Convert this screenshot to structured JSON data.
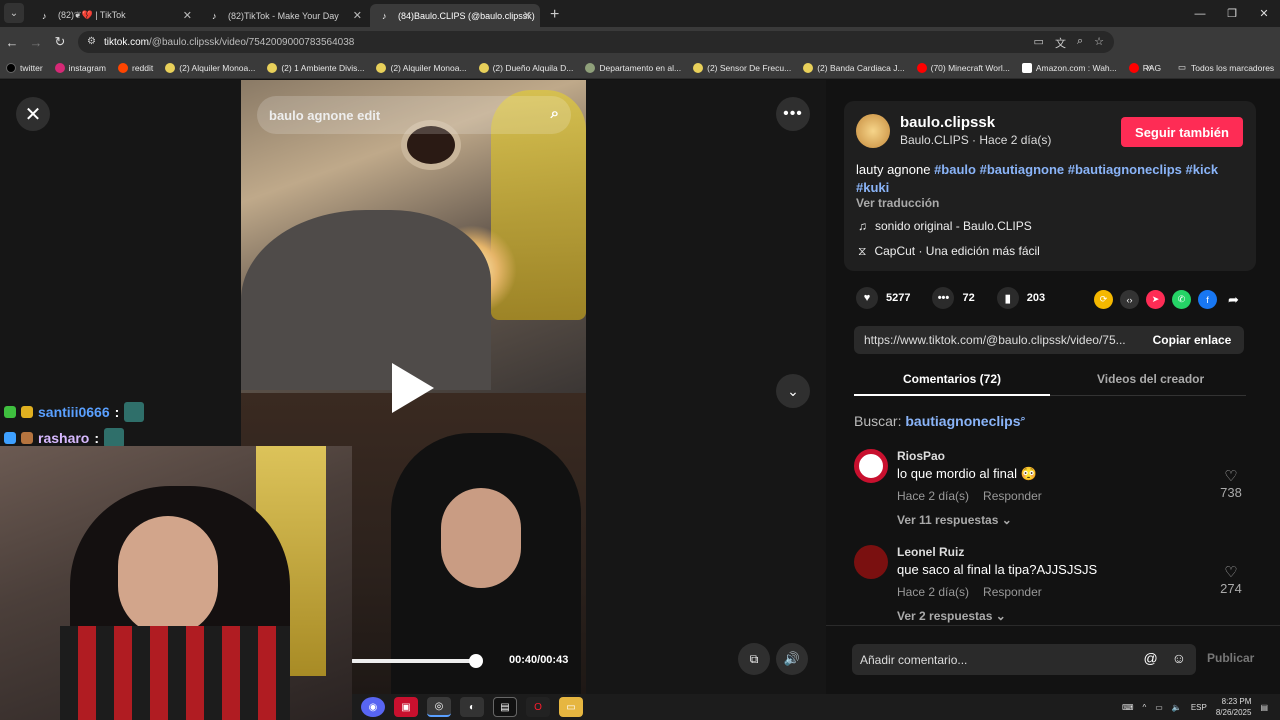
{
  "browser": {
    "tabs": [
      {
        "label": "(82)❦💔 | TikTok",
        "active": false
      },
      {
        "label": "(82)TikTok - Make Your Day",
        "active": false
      },
      {
        "label": "(84)Baulo.CLIPS (@baulo.clipssk)",
        "active": true
      }
    ],
    "url_host": "tiktok.com",
    "url_path": "/@baulo.clipssk/video/7542009000783564038",
    "bookmarks": [
      "twitter",
      "instagram",
      "reddit",
      "(2) Alquiler Monoa...",
      "(2) 1 Ambiente Divis...",
      "(2) Alquiler Monoa...",
      "(2) Dueño Alquila D...",
      "Departamento en al...",
      "(2) Sensor De Frecu...",
      "(2) Banda Cardiaca J...",
      "(70) Minecraft Worl...",
      "Amazon.com : Wah...",
      "RAG"
    ],
    "all_bookmarks": "Todos los marcadores",
    "profile_letter": "B"
  },
  "video": {
    "search_text": "baulo agnone edit",
    "time": "00:40/00:43",
    "progress": 0.93
  },
  "chat": [
    {
      "user": "santiii0666",
      "sep": ":"
    },
    {
      "user": "rasharo",
      "sep": ":"
    }
  ],
  "post": {
    "username": "baulo.clipssk",
    "subtitle": "Baulo.CLIPS · Hace 2 día(s)",
    "follow_label": "Seguir también",
    "desc_text": "lauty agnone ",
    "tags": [
      "#baulo",
      "#bautiagnone",
      "#bautiagnoneclips",
      "#kick",
      "#kuki"
    ],
    "translate": "Ver traducción",
    "sound": "sonido original - Baulo.CLIPS",
    "capcut": "CapCut · Una edición más fácil",
    "likes": "5277",
    "comments": "72",
    "saves": "203",
    "link": "https://www.tiktok.com/@baulo.clipssk/video/75...",
    "copy_label": "Copiar enlace",
    "tab_comments": "Comentarios (72)",
    "tab_videos": "Videos del creador",
    "search_prefix": "Buscar:",
    "search_query": "bautiagnoneclips"
  },
  "comments": [
    {
      "name": "RiosPao",
      "text": "lo que mordio al final 😳",
      "meta_time": "Hace 2 día(s)",
      "reply": "Responder",
      "replies": "Ver 11 respuestas ⌄",
      "likes": "738"
    },
    {
      "name": "Leonel Ruiz",
      "text": "que saco al final la tipa?AJJSJSJS",
      "meta_time": "Hace 2 día(s)",
      "reply": "Responder",
      "replies": "Ver 2 respuestas ⌄",
      "likes": "274"
    }
  ],
  "add_comment": {
    "placeholder": "Añadir comentario...",
    "publish": "Publicar"
  },
  "taskbar": {
    "lang": "ESP",
    "time": "8:23 PM",
    "date": "8/26/2025"
  },
  "colors": {
    "accent": "#fe2c55",
    "link": "#8ab4f8"
  }
}
